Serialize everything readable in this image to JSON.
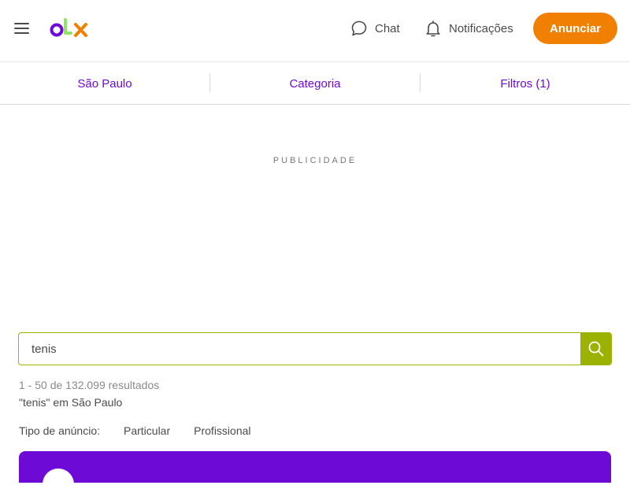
{
  "header": {
    "logo_text": "olx",
    "chat_label": "Chat",
    "notifications_label": "Notificações",
    "post_ad_label": "Anunciar"
  },
  "filters": {
    "location": "São Paulo",
    "category": "Categoria",
    "filters": "Filtros (1)"
  },
  "ad": {
    "label": "PUBLICIDADE"
  },
  "search": {
    "value": "tenis"
  },
  "results": {
    "count_text": "1 - 50 de 132.099 resultados",
    "query_text": "\"tenis\" em São Paulo"
  },
  "ad_type": {
    "label": "Tipo de anúncio:",
    "options": [
      "Particular",
      "Profissional"
    ]
  },
  "colors": {
    "brand_purple": "#6e0ad6",
    "brand_orange": "#f28000",
    "brand_green": "#9cb200"
  },
  "icons": {
    "menu": "hamburger-icon",
    "chat": "chat-bubble-icon",
    "notifications": "bell-icon",
    "search": "magnifier-icon"
  }
}
